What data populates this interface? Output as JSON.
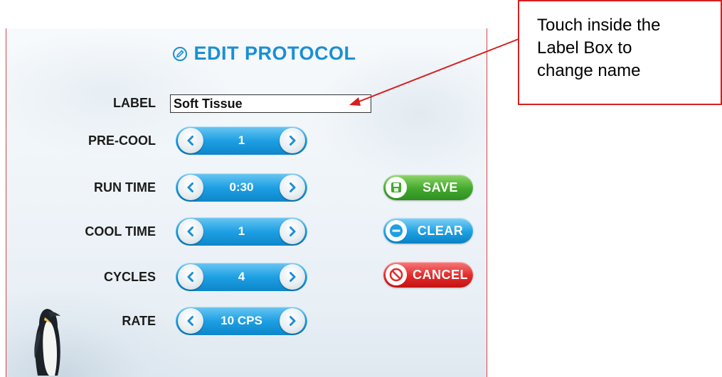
{
  "screen": {
    "title": "EDIT PROTOCOL",
    "label_field": {
      "label": "LABEL",
      "value": "Soft Tissue"
    },
    "steppers": [
      {
        "label": "PRE-COOL",
        "value": "1"
      },
      {
        "label": "RUN TIME",
        "value": "0:30"
      },
      {
        "label": "COOL TIME",
        "value": "1"
      },
      {
        "label": "CYCLES",
        "value": "4"
      },
      {
        "label": "RATE",
        "value": "10 CPS"
      }
    ],
    "actions": {
      "save": "SAVE",
      "clear": "CLEAR",
      "cancel": "CANCEL"
    }
  },
  "annotation": {
    "lines": [
      "Touch inside the",
      "Label Box to",
      "change name"
    ]
  },
  "colors": {
    "accent_blue": "#1a8fd6",
    "save_green": "#43a82d",
    "clear_blue": "#1da0e3",
    "cancel_red": "#e22929",
    "annotation_red": "#d42020"
  },
  "icons": {
    "title": "edit-pencil-circle-icon",
    "stepper_left": "chevron-left-icon",
    "stepper_right": "chevron-right-icon",
    "save": "floppy-disk-icon",
    "clear": "minus-circle-icon",
    "cancel": "prohibited-icon"
  }
}
